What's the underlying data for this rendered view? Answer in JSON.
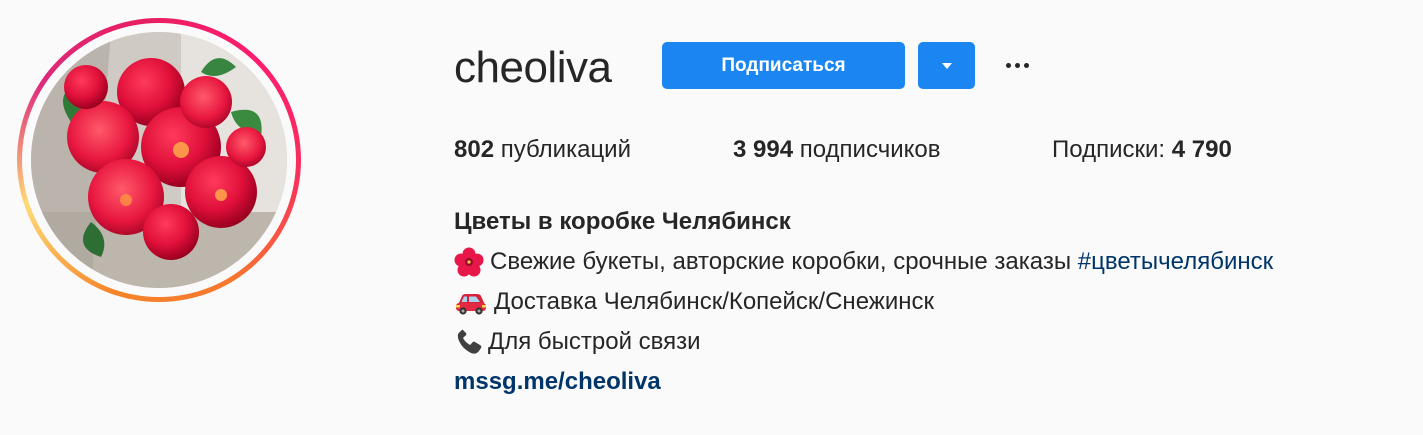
{
  "profile": {
    "username": "cheoliva",
    "avatar_icon": "flower-bouquet-photo"
  },
  "actions": {
    "follow_label": "Подписаться",
    "dropdown_icon": "chevron-down-icon",
    "more_icon": "ellipsis-icon"
  },
  "stats": {
    "posts_count": "802",
    "posts_label": "публикаций",
    "followers_count": "3 994",
    "followers_label": "подписчиков",
    "following_label": "Подписки:",
    "following_count": "4 790"
  },
  "bio": {
    "full_name": "Цветы в коробке Челябинск",
    "line1_emoji": "hibiscus",
    "line1_text": "Свежие букеты, авторские коробки, срочные заказы",
    "line1_hashtag": "#цветычелябинск",
    "line2_emoji": "car",
    "line2_text": "Доставка Челябинск/Копейск/Снежинск",
    "line3_emoji": "telephone",
    "line3_text": "Для быстрой связи",
    "link": "mssg.me/cheoliva"
  },
  "colors": {
    "accent": "#1b86f2",
    "text": "#262626",
    "link": "#003569",
    "background": "#fafafa"
  }
}
